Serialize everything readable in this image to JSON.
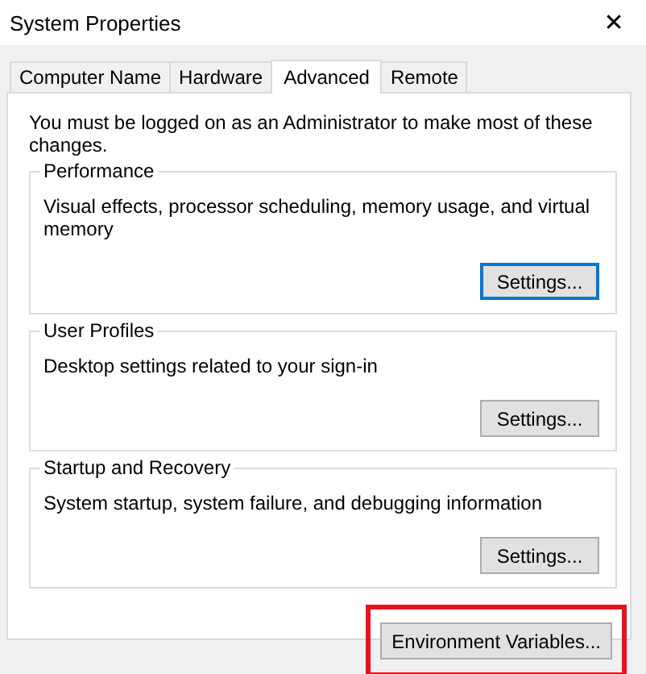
{
  "window": {
    "title": "System Properties",
    "close": "✕"
  },
  "tabs": [
    {
      "label": "Computer Name",
      "selected": false
    },
    {
      "label": "Hardware",
      "selected": false
    },
    {
      "label": "Advanced",
      "selected": true
    },
    {
      "label": "Remote",
      "selected": false
    }
  ],
  "notice": "You must be logged on as an Administrator to make most of these changes.",
  "groups": [
    {
      "title": "Performance",
      "description": "Visual effects, processor scheduling, memory usage, and virtual memory",
      "button": "Settings...",
      "focused": true
    },
    {
      "title": "User Profiles",
      "description": "Desktop settings related to your sign-in",
      "button": "Settings...",
      "focused": false
    },
    {
      "title": "Startup and Recovery",
      "description": "System startup, system failure, and debugging information",
      "button": "Settings...",
      "focused": false
    }
  ],
  "environment_button": {
    "label": "Environment Variables...",
    "highlighted": true
  }
}
